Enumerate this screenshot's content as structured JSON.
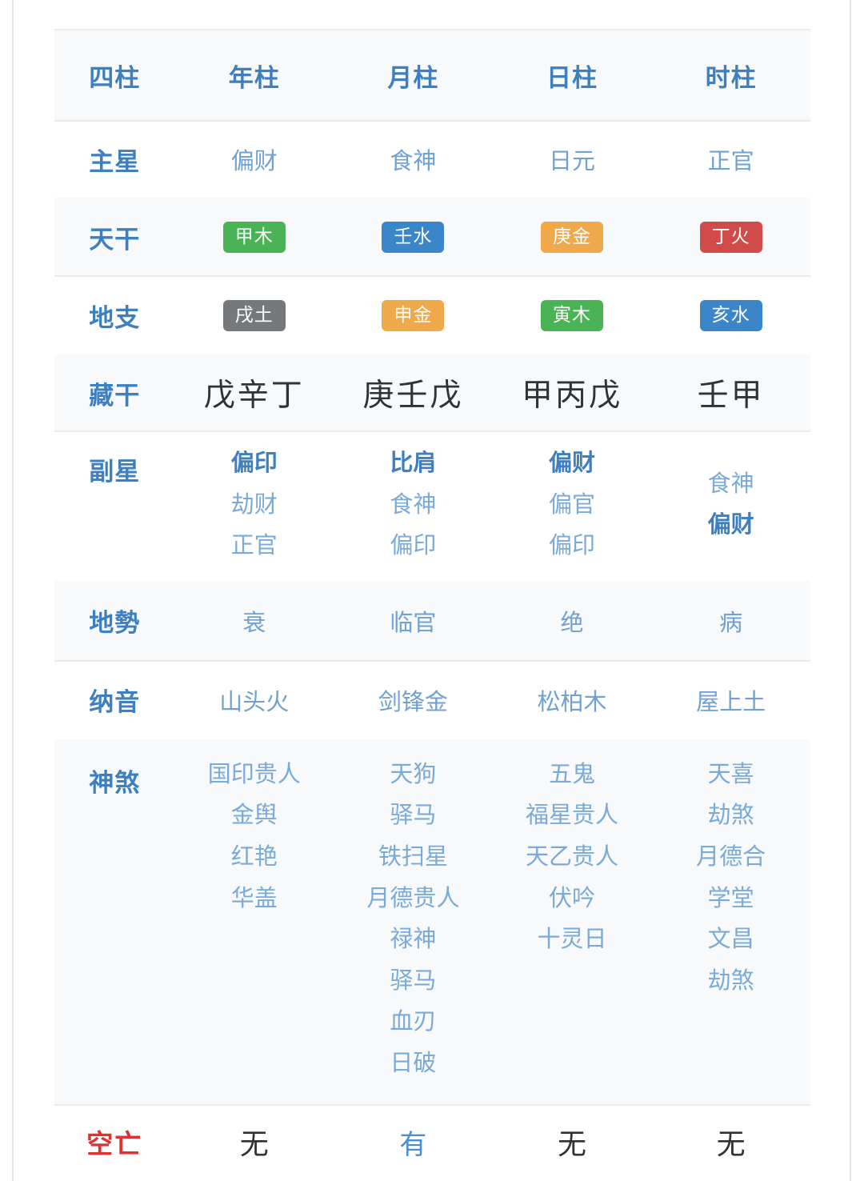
{
  "table": {
    "columns": [
      "四柱",
      "年柱",
      "月柱",
      "日柱",
      "时柱"
    ],
    "header": {
      "label": "四柱",
      "year": "年柱",
      "month": "月柱",
      "day": "日柱",
      "hour": "时柱"
    },
    "main_star": {
      "label": "主星",
      "year": "偏财",
      "month": "食神",
      "day": "日元",
      "hour": "正官"
    },
    "heavenly_stem": {
      "label": "天干",
      "year": {
        "text": "甲木",
        "element": "wood",
        "color": "#49b356"
      },
      "month": {
        "text": "壬水",
        "element": "water",
        "color": "#3b86c9"
      },
      "day": {
        "text": "庚金",
        "element": "metal",
        "color": "#efa94b"
      },
      "hour": {
        "text": "丁火",
        "element": "fire",
        "color": "#d24b4b"
      }
    },
    "earthly_branch": {
      "label": "地支",
      "year": {
        "text": "戌土",
        "element": "earth",
        "color": "#76797c"
      },
      "month": {
        "text": "申金",
        "element": "metal",
        "color": "#efa94b"
      },
      "day": {
        "text": "寅木",
        "element": "wood",
        "color": "#49b356"
      },
      "hour": {
        "text": "亥水",
        "element": "water",
        "color": "#3b86c9"
      }
    },
    "hidden_stems": {
      "label": "藏干",
      "year": "戊辛丁",
      "month": "庚壬戊",
      "day": "甲丙戊",
      "hour": "壬甲"
    },
    "sub_star": {
      "label": "副星",
      "year": [
        {
          "text": "偏印",
          "strong": true
        },
        {
          "text": "劫财",
          "strong": false
        },
        {
          "text": "正官",
          "strong": false
        }
      ],
      "month": [
        {
          "text": "比肩",
          "strong": true
        },
        {
          "text": "食神",
          "strong": false
        },
        {
          "text": "偏印",
          "strong": false
        }
      ],
      "day": [
        {
          "text": "偏财",
          "strong": true
        },
        {
          "text": "偏官",
          "strong": false
        },
        {
          "text": "偏印",
          "strong": false
        }
      ],
      "hour": [
        {
          "text": "食神",
          "strong": false
        },
        {
          "text": "偏财",
          "strong": true
        }
      ]
    },
    "power": {
      "label": "地勢",
      "year": "衰",
      "month": "临官",
      "day": "绝",
      "hour": "病"
    },
    "sound": {
      "label": "纳音",
      "year": "山头火",
      "month": "剑锋金",
      "day": "松柏木",
      "hour": "屋上土"
    },
    "spirits": {
      "label": "神煞",
      "year": [
        "国印贵人",
        "金舆",
        "红艳",
        "华盖"
      ],
      "month": [
        "天狗",
        "驿马",
        "铁扫星",
        "月德贵人",
        "禄神",
        "驿马",
        "血刃",
        "日破"
      ],
      "day": [
        "五鬼",
        "福星贵人",
        "天乙贵人",
        "伏吟",
        "十灵日"
      ],
      "hour": [
        "天喜",
        "劫煞",
        "月德合",
        "学堂",
        "文昌",
        "劫煞"
      ]
    },
    "void": {
      "label": "空亡",
      "year": "无",
      "month": "有",
      "day": "无",
      "hour": "无",
      "label_color": "#e03131",
      "accent_color": "#4a8fd0"
    }
  },
  "theme": {
    "label_color": "#3d7fbf",
    "value_color": "#6fa1d2",
    "stripe_bg": "#f7f9fa",
    "row_border": "#e8eaec",
    "dark_text": "#2f3336"
  }
}
